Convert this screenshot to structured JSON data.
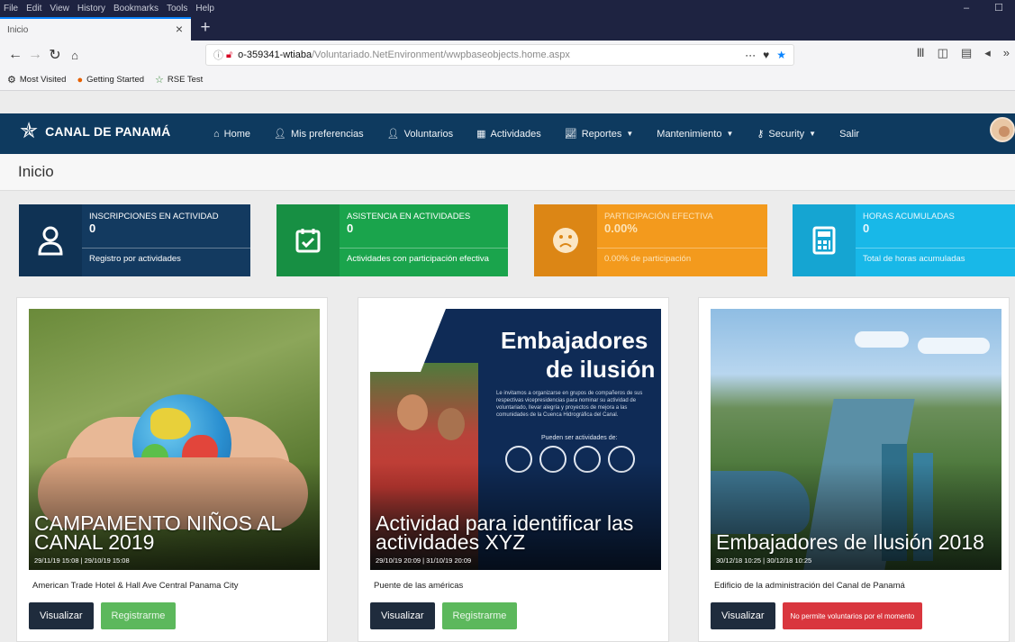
{
  "browser": {
    "menu": [
      "File",
      "Edit",
      "View",
      "History",
      "Bookmarks",
      "Tools",
      "Help"
    ],
    "tab_title": "Inicio",
    "url_host": "o-359341-wtiaba",
    "url_path": "/Voluntariado.NetEnvironment/wwpbaseobjects.home.aspx",
    "bookmarks": [
      "Most Visited",
      "Getting Started",
      "RSE Test"
    ]
  },
  "app": {
    "brand": "CANAL DE PANAMÁ",
    "nav": [
      {
        "label": "Home",
        "icon": "home-icon"
      },
      {
        "label": "Mis preferencias",
        "icon": "user-settings-icon"
      },
      {
        "label": "Voluntarios",
        "icon": "user-icon"
      },
      {
        "label": "Actividades",
        "icon": "calendar-icon"
      },
      {
        "label": "Reportes",
        "icon": "chart-icon"
      },
      {
        "label": "Mantenimiento",
        "icon": ""
      },
      {
        "label": "Security",
        "icon": "key-icon"
      },
      {
        "label": "Salir",
        "icon": ""
      }
    ]
  },
  "page_title": "Inicio",
  "stats": [
    {
      "title": "INSCRIPCIONES EN ACTIVIDAD",
      "value": "0",
      "footer": "Registro por actividades",
      "icon": "user-icon"
    },
    {
      "title": "ASISTENCIA EN ACTIVIDADES",
      "value": "0",
      "footer": "Actividades con participación efectiva",
      "icon": "calendar-check-icon"
    },
    {
      "title": "PARTICIPACIÓN EFECTIVA",
      "value": "0.00%",
      "footer": "0.00% de participación",
      "icon": "sad-face-icon"
    },
    {
      "title": "HORAS ACUMULADAS",
      "value": "0",
      "footer": "Total de horas acumuladas",
      "icon": "calculator-icon"
    }
  ],
  "cards": [
    {
      "title": "CAMPAMENTO NIÑOS AL CANAL 2019",
      "dates": "29/11/19 15:08  |  29/10/19 15:08",
      "location": "American Trade Hotel & Hall Ave Central Panama City",
      "btn_view": "Visualizar",
      "btn_action": "Registrarme"
    },
    {
      "title": "Actividad para identificar las actividades XYZ",
      "dates": "29/10/19 20:09  |  31/10/19 20:09",
      "location": "Puente de las américas",
      "btn_view": "Visualizar",
      "btn_action": "Registrarme",
      "poster": {
        "heading1": "Embajadores",
        "heading2": "de ilusión",
        "body": "Le invitamos a organizarse en grupos de compañeros de sus respectivas vicepresidencias para nominar su actividad de voluntariado, llevar alegría y proyectos de mejora a las comunidades de la Cuenca Hidrográfica del Canal.",
        "sub": "Pueden ser actividades de:"
      }
    },
    {
      "title": "Embajadores de Ilusión 2018",
      "dates": "30/12/18 10:25  |  30/12/18 10:25",
      "location": "Edificio de la administración del Canal de Panamá",
      "btn_view": "Visualizar",
      "btn_action": "No permite voluntarios por el momento"
    }
  ]
}
